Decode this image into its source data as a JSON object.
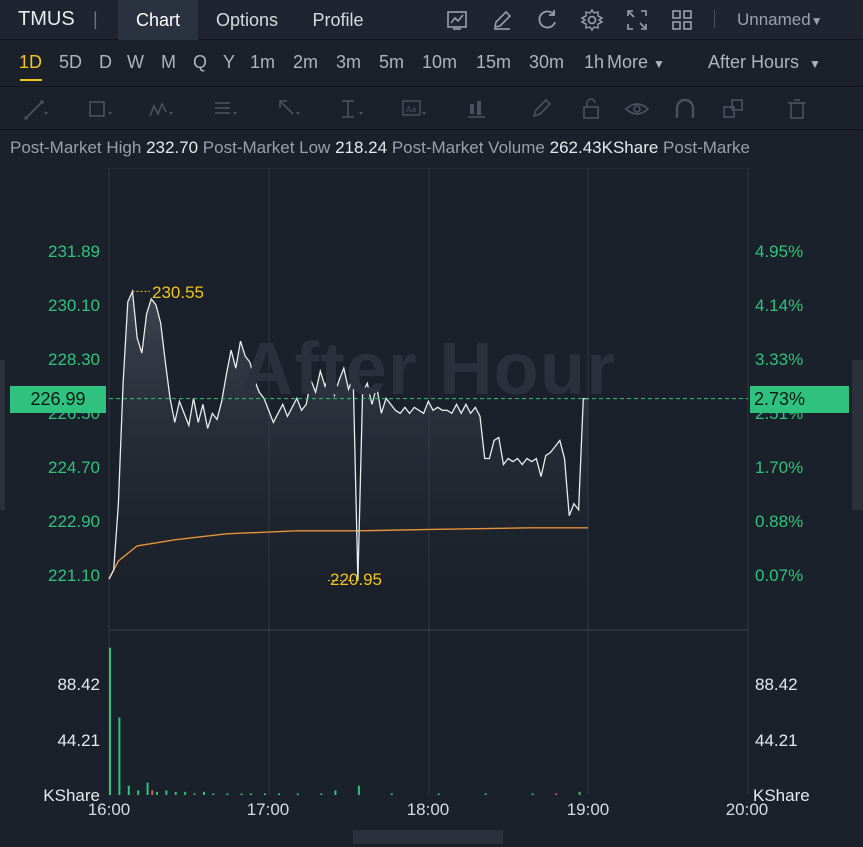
{
  "header": {
    "ticker": "TMUS",
    "tabs": [
      "Chart",
      "Options",
      "Profile"
    ],
    "workspace": "Unnamed"
  },
  "periods": {
    "items": [
      "1D",
      "5D",
      "D",
      "W",
      "M",
      "Q",
      "Y",
      "1m",
      "2m",
      "3m",
      "5m",
      "10m",
      "15m",
      "30m",
      "1h"
    ],
    "more": "More",
    "active": "1D",
    "session": "After Hours"
  },
  "stats": {
    "high_label": "Post-Market High",
    "high_value": "232.70",
    "low_label": "Post-Market Low",
    "low_value": "218.24",
    "volume_label": "Post-Market Volume",
    "volume_value": "262.43KShare",
    "trailing_label": "Post-Marke"
  },
  "chart_data": {
    "type": "line",
    "watermark": "After Hour",
    "price_ticks": [
      "231.89",
      "230.10",
      "228.30",
      "226.50",
      "224.70",
      "222.90",
      "221.10"
    ],
    "pct_ticks": [
      "4.95%",
      "4.14%",
      "3.33%",
      "2.51%",
      "1.70%",
      "0.88%",
      "0.07%"
    ],
    "current_price": "226.99",
    "current_pct": "2.73%",
    "high_marker": "230.55",
    "low_marker": "220.95",
    "volume_ticks": [
      "88.42",
      "44.21"
    ],
    "volume_unit": "KShare",
    "time_labels": [
      "16:00",
      "17:00",
      "18:00",
      "19:00",
      "20:00"
    ],
    "ylim": [
      220.3,
      233.5
    ],
    "price_series": [
      [
        0,
        221.0
      ],
      [
        1,
        221.3
      ],
      [
        2,
        223.5
      ],
      [
        3,
        227.5
      ],
      [
        4,
        230.2
      ],
      [
        5,
        230.55
      ],
      [
        6,
        229.0
      ],
      [
        7,
        228.5
      ],
      [
        8,
        229.8
      ],
      [
        9,
        230.3
      ],
      [
        10,
        230.1
      ],
      [
        11,
        229.5
      ],
      [
        12,
        228.2
      ],
      [
        13,
        227.0
      ],
      [
        14,
        226.2
      ],
      [
        15,
        226.9
      ],
      [
        16,
        226.5
      ],
      [
        17,
        226.1
      ],
      [
        18,
        227.0
      ],
      [
        19,
        226.2
      ],
      [
        20,
        226.8
      ],
      [
        21,
        226.0
      ],
      [
        22,
        226.5
      ],
      [
        23,
        226.3
      ],
      [
        24,
        226.9
      ],
      [
        25,
        227.8
      ],
      [
        26,
        228.6
      ],
      [
        27,
        228.0
      ],
      [
        28,
        228.9
      ],
      [
        29,
        228.4
      ],
      [
        30,
        228.2
      ],
      [
        31,
        227.6
      ],
      [
        32,
        227.2
      ],
      [
        33,
        227.0
      ],
      [
        34,
        226.6
      ],
      [
        35,
        226.2
      ],
      [
        36,
        226.5
      ],
      [
        37,
        226.8
      ],
      [
        38,
        226.4
      ],
      [
        39,
        226.7
      ],
      [
        40,
        227.0
      ],
      [
        41,
        226.6
      ],
      [
        42,
        226.8
      ],
      [
        43,
        227.6
      ],
      [
        44,
        227.2
      ],
      [
        45,
        227.9
      ],
      [
        46,
        227.4
      ],
      [
        47,
        227.8
      ],
      [
        48,
        227.1
      ],
      [
        49,
        227.6
      ],
      [
        50,
        228.0
      ],
      [
        51,
        227.3
      ],
      [
        52,
        227.7
      ],
      [
        53,
        220.95
      ],
      [
        54,
        227.2
      ],
      [
        55,
        227.5
      ],
      [
        56,
        226.8
      ],
      [
        57,
        227.4
      ],
      [
        58,
        226.5
      ],
      [
        59,
        227.0
      ],
      [
        60,
        226.8
      ],
      [
        61,
        226.6
      ],
      [
        62,
        226.5
      ],
      [
        63,
        226.7
      ],
      [
        64,
        226.5
      ],
      [
        65,
        226.7
      ],
      [
        66,
        226.6
      ],
      [
        67,
        226.5
      ],
      [
        68,
        226.9
      ],
      [
        69,
        226.6
      ],
      [
        70,
        226.7
      ],
      [
        71,
        226.6
      ],
      [
        72,
        226.6
      ],
      [
        73,
        226.5
      ],
      [
        74,
        226.8
      ],
      [
        75,
        226.5
      ],
      [
        76,
        226.8
      ],
      [
        77,
        226.5
      ],
      [
        78,
        226.7
      ],
      [
        79,
        226.4
      ],
      [
        80,
        225.0
      ],
      [
        81,
        225.0
      ],
      [
        82,
        225.6
      ],
      [
        83,
        225.7
      ],
      [
        84,
        224.8
      ],
      [
        85,
        225.0
      ],
      [
        86,
        224.9
      ],
      [
        87,
        225.0
      ],
      [
        88,
        224.8
      ],
      [
        89,
        225.0
      ],
      [
        90,
        224.9
      ],
      [
        91,
        225.0
      ],
      [
        92,
        224.4
      ],
      [
        93,
        225.1
      ],
      [
        94,
        225.2
      ],
      [
        95,
        225.4
      ],
      [
        96,
        225.6
      ],
      [
        97,
        225.0
      ],
      [
        98,
        223.1
      ],
      [
        99,
        223.5
      ],
      [
        100,
        223.3
      ],
      [
        101,
        226.99
      ],
      [
        102,
        226.99
      ]
    ],
    "avg_series": [
      [
        0,
        221.0
      ],
      [
        2,
        221.6
      ],
      [
        6,
        222.1
      ],
      [
        14,
        222.3
      ],
      [
        25,
        222.5
      ],
      [
        40,
        222.6
      ],
      [
        53,
        222.6
      ],
      [
        70,
        222.65
      ],
      [
        90,
        222.7
      ],
      [
        102,
        222.7
      ]
    ],
    "volume_series": [
      [
        0,
        95
      ],
      [
        2,
        50
      ],
      [
        4,
        6
      ],
      [
        6,
        3
      ],
      [
        8,
        8
      ],
      [
        9,
        3
      ],
      [
        10,
        2
      ],
      [
        12,
        3
      ],
      [
        14,
        2
      ],
      [
        16,
        2
      ],
      [
        18,
        1
      ],
      [
        20,
        2
      ],
      [
        22,
        1
      ],
      [
        25,
        1
      ],
      [
        28,
        1
      ],
      [
        30,
        1
      ],
      [
        33,
        1
      ],
      [
        36,
        1
      ],
      [
        40,
        1
      ],
      [
        45,
        1
      ],
      [
        48,
        3
      ],
      [
        53,
        6
      ],
      [
        60,
        1
      ],
      [
        70,
        1
      ],
      [
        80,
        1
      ],
      [
        90,
        1
      ],
      [
        95,
        1
      ],
      [
        100,
        2
      ]
    ]
  }
}
